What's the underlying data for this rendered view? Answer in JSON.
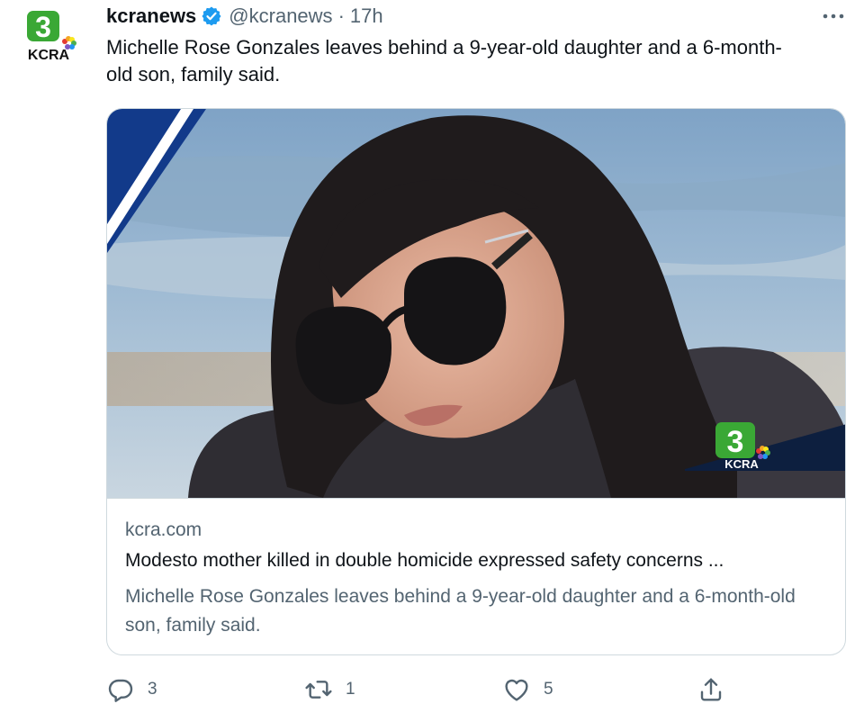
{
  "tweet": {
    "display_name": "kcranews",
    "handle": "@kcranews",
    "separator": "·",
    "time": "17h",
    "text": "Michelle Rose Gonzales leaves behind a 9-year-old daughter and a 6-month-old son, family said."
  },
  "avatar": {
    "logo_number": "3",
    "logo_text": "KCRA"
  },
  "card": {
    "image_logo_number": "3",
    "image_logo_text": "KCRA",
    "domain": "kcra.com",
    "title": "Modesto mother killed in double homicide expressed safety concerns ...",
    "description": "Michelle Rose Gonzales leaves behind a 9-year-old daughter and a 6-month-old son, family said."
  },
  "actions": {
    "reply_count": "3",
    "retweet_count": "1",
    "like_count": "5"
  },
  "icons": [
    "verified-badge-icon",
    "more-icon",
    "reply-icon",
    "retweet-icon",
    "like-icon",
    "share-icon"
  ],
  "colors": {
    "brand_green": "#3aa835",
    "verified_blue": "#1d9bf0",
    "muted_text": "#536471",
    "border": "#cfd9de"
  }
}
